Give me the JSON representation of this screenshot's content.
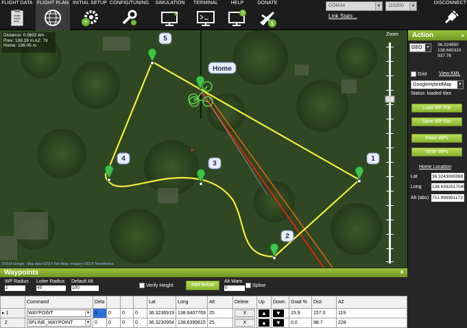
{
  "toolbar": {
    "tabs": [
      {
        "label": "FLIGHT DATA",
        "icon": "clipboard-icon"
      },
      {
        "label": "FLIGHT PLAN",
        "icon": "globe-icon"
      },
      {
        "label": "INITIAL SETUP",
        "icon": "gear-plus-icon"
      },
      {
        "label": "CONFIG/TUNING",
        "icon": "wrench-icon"
      },
      {
        "label": "SIMULATION",
        "icon": "monitor-plane-icon"
      },
      {
        "label": "TERMINAL",
        "icon": "terminal-icon"
      },
      {
        "label": "HELP",
        "icon": "help-monitor-icon"
      },
      {
        "label": "DONATE",
        "icon": "plane-dollar-icon"
      }
    ],
    "active_tab": "FLIGHT PLAN",
    "com_port": "COM34",
    "baud": "115200",
    "link_stats": "Link Stats...",
    "disconnect": "DISCONNECT"
  },
  "map": {
    "info": {
      "distance": "Distance: 0.5602 km",
      "prev": "Prev: 138.28 m AZ: 79",
      "home": "Home: 108.05 m"
    },
    "home_label": "Home",
    "waypoint_labels": [
      "1",
      "2",
      "3",
      "4",
      "5"
    ],
    "copyright": "©2014 Google - Map data ©2014 Tele Atlas, Imagery ©2014 TerraMetrics",
    "zoom_label": "Zoom"
  },
  "action": {
    "title": "Action",
    "coord_system": "GEO",
    "lat": "36.324850",
    "lng": "138.640310",
    "alt": "937.76",
    "grid_label": "Grid",
    "view_kml": "View KML",
    "map_type": "GoogleHybridMap",
    "status": "Status: loaded tiles",
    "buttons": {
      "load": "Load WP File",
      "save": "Save WP File",
      "read": "Read WPs",
      "write": "Write WPs"
    },
    "home_location": "Home Location",
    "home_lat_label": "Lat",
    "home_lat": "36.3243065998",
    "home_long_label": "Long",
    "home_long": "138.6392517049",
    "home_alt_label": "Alt (abs)",
    "home_alt": "751.999951172"
  },
  "waypoints": {
    "title": "Waypoints",
    "wp_radius_label": "WP Radius",
    "wp_radius": "2",
    "loiter_radius_label": "Loiter Radius",
    "loiter_radius": "45",
    "default_alt_label": "Default Alt",
    "default_alt": "100",
    "verify_height": "Verify Height",
    "add_below": "Add Below",
    "alt_warn_label": "Alt Warn",
    "alt_warn": "0",
    "spline": "Spline",
    "columns": [
      "",
      "Command",
      "Dela",
      "",
      "",
      "",
      "Lat",
      "Long",
      "Alt",
      "Delete",
      "Up",
      "Down",
      "Grad %",
      "Dist",
      "AZ"
    ],
    "rows": [
      {
        "num": "1",
        "command": "WAYPOINT",
        "p1": "1",
        "p2": "0",
        "p3": "0",
        "p4": "0",
        "lat": "36.3236919",
        "lng": "138.6407769",
        "alt": "25",
        "delete": "X",
        "grad": "15.9",
        "dist": "157.0",
        "az": "119"
      },
      {
        "num": "2",
        "command": "SPLINE_WAYPOINT",
        "p1": "0",
        "p2": "0",
        "p3": "0",
        "p4": "0",
        "lat": "36.3230954",
        "lng": "138.6399615",
        "alt": "25",
        "delete": "X",
        "grad": "0.0",
        "dist": "98.7",
        "az": "228"
      }
    ]
  }
}
